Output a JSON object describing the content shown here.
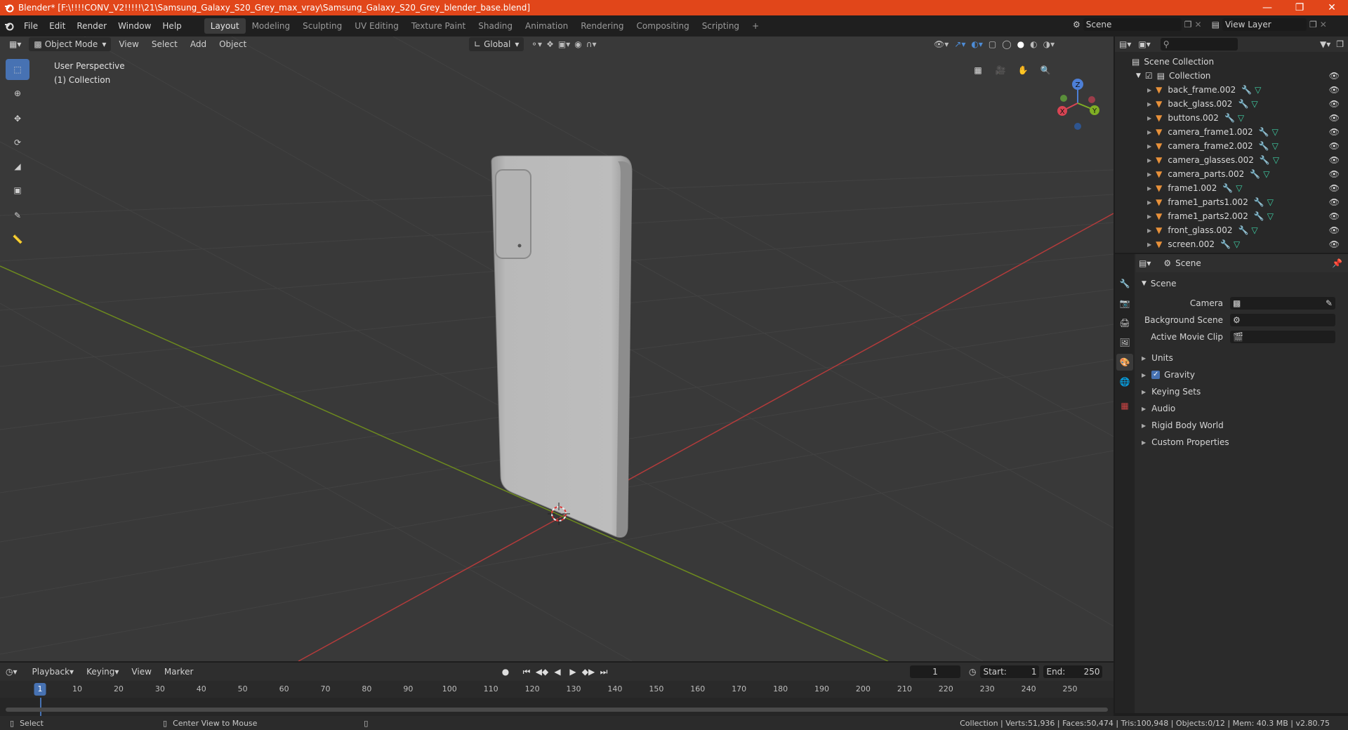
{
  "window": {
    "title": "Blender* [F:\\!!!!CONV_V2!!!!!\\21\\Samsung_Galaxy_S20_Grey_max_vray\\Samsung_Galaxy_S20_Grey_blender_base.blend]",
    "title_color": "#e1461a"
  },
  "menubar": {
    "items": [
      "File",
      "Edit",
      "Render",
      "Window",
      "Help"
    ],
    "workspaces": [
      "Layout",
      "Modeling",
      "Sculpting",
      "UV Editing",
      "Texture Paint",
      "Shading",
      "Animation",
      "Rendering",
      "Compositing",
      "Scripting"
    ],
    "add_tab": "+",
    "scene_name": "Scene",
    "view_layer_name": "View Layer"
  },
  "viewport_header": {
    "mode": "Object Mode",
    "menus": [
      "View",
      "Select",
      "Add",
      "Object"
    ],
    "orientation": "Global"
  },
  "viewport": {
    "perspective": "User Perspective",
    "collection": "(1) Collection",
    "axis_labels": {
      "z": "Z",
      "y": "Y",
      "x": "X"
    },
    "background": "#393939",
    "x_axis_color": "#b33b3b",
    "y_axis_color": "#6d8a1e"
  },
  "outliner": {
    "root": "Scene Collection",
    "collection": "Collection",
    "objects": [
      "back_frame.002",
      "back_glass.002",
      "buttons.002",
      "camera_frame1.002",
      "camera_frame2.002",
      "camera_glasses.002",
      "camera_parts.002",
      "frame1.002",
      "frame1_parts1.002",
      "frame1_parts2.002",
      "front_glass.002",
      "screen.002"
    ]
  },
  "properties": {
    "context": "Scene",
    "panel_title": "Scene",
    "camera_label": "Camera",
    "background_scene_label": "Background Scene",
    "active_movie_clip_label": "Active Movie Clip",
    "subpanels": [
      "Units",
      "Gravity",
      "Keying Sets",
      "Audio",
      "Rigid Body World",
      "Custom Properties"
    ],
    "gravity_checked": true
  },
  "timeline": {
    "menus": [
      "Playback",
      "Keying",
      "View",
      "Marker"
    ],
    "current_frame": "1",
    "start_label": "Start:",
    "start": "1",
    "end_label": "End:",
    "end": "250",
    "ticks": [
      "1",
      "10",
      "20",
      "30",
      "40",
      "50",
      "60",
      "70",
      "80",
      "90",
      "100",
      "110",
      "120",
      "130",
      "140",
      "150",
      "160",
      "170",
      "180",
      "190",
      "200",
      "210",
      "220",
      "230",
      "240",
      "250"
    ]
  },
  "statusbar": {
    "left_action": "Select",
    "mid_action": "Center View to Mouse",
    "stats": "Collection | Verts:51,936 | Faces:50,474 | Tris:100,948 | Objects:0/12 | Mem: 40.3 MB | v2.80.75"
  }
}
